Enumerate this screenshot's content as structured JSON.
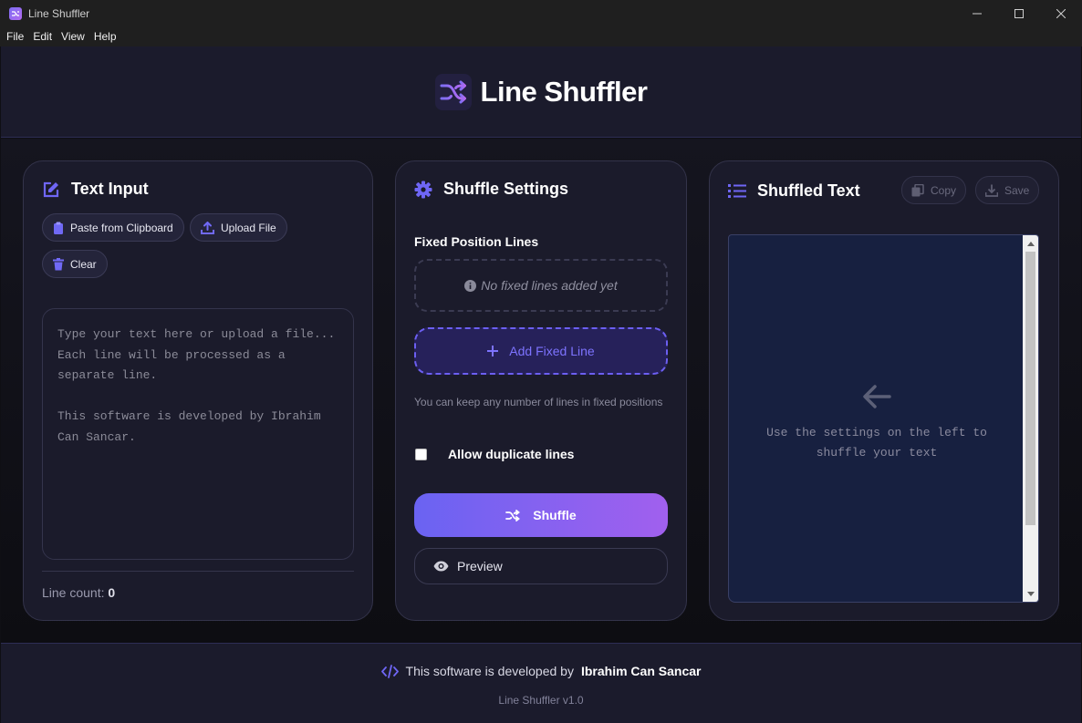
{
  "window": {
    "title": "Line Shuffler"
  },
  "menu": [
    "File",
    "Edit",
    "View",
    "Help"
  ],
  "header": {
    "title": "Line Shuffler",
    "icon": "shuffle-icon",
    "accent": "#7c6cf2"
  },
  "text_input": {
    "title": "Text Input",
    "paste_label": "Paste from Clipboard",
    "upload_label": "Upload File",
    "clear_label": "Clear",
    "placeholder": "Type your text here or upload a file...\nEach line will be processed as a separate line.\n\nThis software is developed by Ibrahim Can Sancar.",
    "line_count_label": "Line count:",
    "line_count": "0"
  },
  "settings": {
    "title": "Shuffle Settings",
    "fixed_label": "Fixed Position Lines",
    "empty_text": "No fixed lines added yet",
    "add_fixed_label": "Add Fixed Line",
    "hint": "You can keep any number of lines in fixed positions",
    "allow_duplicates_label": "Allow duplicate lines",
    "allow_duplicates": false,
    "shuffle_label": "Shuffle",
    "preview_label": "Preview"
  },
  "output": {
    "title": "Shuffled Text",
    "copy_label": "Copy",
    "save_label": "Save",
    "empty_message": "Use the settings on the left to shuffle your text"
  },
  "footer": {
    "developed_by": "This software is developed by",
    "author": "Ibrahim Can Sancar",
    "version": "Line Shuffler v1.0"
  }
}
